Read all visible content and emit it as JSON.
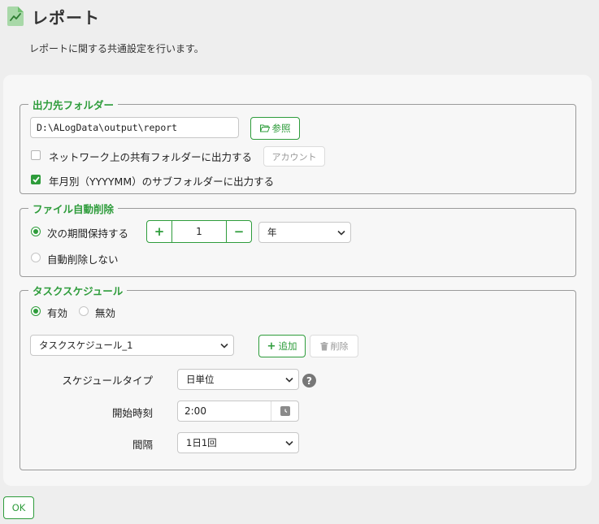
{
  "header": {
    "title": "レポート",
    "description": "レポートに関する共通設定を行います。"
  },
  "output_folder": {
    "legend": "出力先フォルダー",
    "path_value": "D:\\ALogData\\output\\report",
    "browse_label": "参照",
    "shared_label": "ネットワーク上の共有フォルダーに出力する",
    "shared_checked": false,
    "account_label": "アカウント",
    "subfolder_label": "年月別（YYYYMM）のサブフォルダーに出力する",
    "subfolder_checked": true
  },
  "auto_delete": {
    "legend": "ファイル自動削除",
    "keep_label": "次の期間保持する",
    "keep_selected": true,
    "period_value": "1",
    "unit_value": "年",
    "no_delete_label": "自動削除しない"
  },
  "schedule": {
    "legend": "タスクスケジュール",
    "enabled_label": "有効",
    "disabled_label": "無効",
    "enabled": true,
    "selected_schedule": "タスクスケジュール_1",
    "add_label": "追加",
    "delete_label": "削除",
    "type_label": "スケジュールタイプ",
    "type_value": "日単位",
    "start_label": "開始時刻",
    "start_value": "2:00",
    "interval_label": "間隔",
    "interval_value": "1日1回"
  },
  "footer": {
    "ok_label": "OK"
  },
  "colors": {
    "accent": "#2e9c3b",
    "background": "#eeeeee",
    "card": "#f7f7f7"
  },
  "icons": [
    "report-doc-icon",
    "folder-open-icon",
    "check-icon",
    "plus-icon",
    "minus-icon",
    "trash-icon",
    "chevron-down-icon",
    "help-icon",
    "clock-icon"
  ]
}
